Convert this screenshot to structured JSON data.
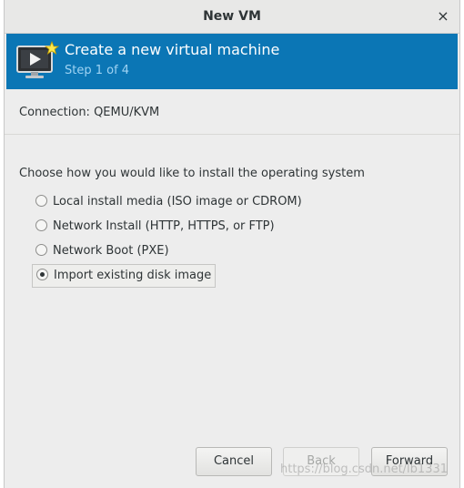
{
  "window": {
    "title": "New VM",
    "close_icon": "×"
  },
  "banner": {
    "title": "Create a new virtual machine",
    "step": "Step 1 of 4",
    "icon": "monitor-new-icon"
  },
  "connection": {
    "text": "Connection:  QEMU/KVM"
  },
  "install": {
    "prompt": "Choose how you would like to install the operating system",
    "options": [
      {
        "label": "Local install media (ISO image or CDROM)",
        "selected": false
      },
      {
        "label": "Network Install (HTTP, HTTPS, or FTP)",
        "selected": false
      },
      {
        "label": "Network Boot (PXE)",
        "selected": false
      },
      {
        "label": "Import existing disk image",
        "selected": true
      }
    ]
  },
  "buttons": {
    "cancel": "Cancel",
    "back": "Back",
    "forward": "Forward"
  },
  "watermark": "https://blog.csdn.net/lb1331",
  "colors": {
    "banner": "#0b76b5",
    "step_text": "#9fd3f3",
    "window_bg": "#ededed"
  }
}
